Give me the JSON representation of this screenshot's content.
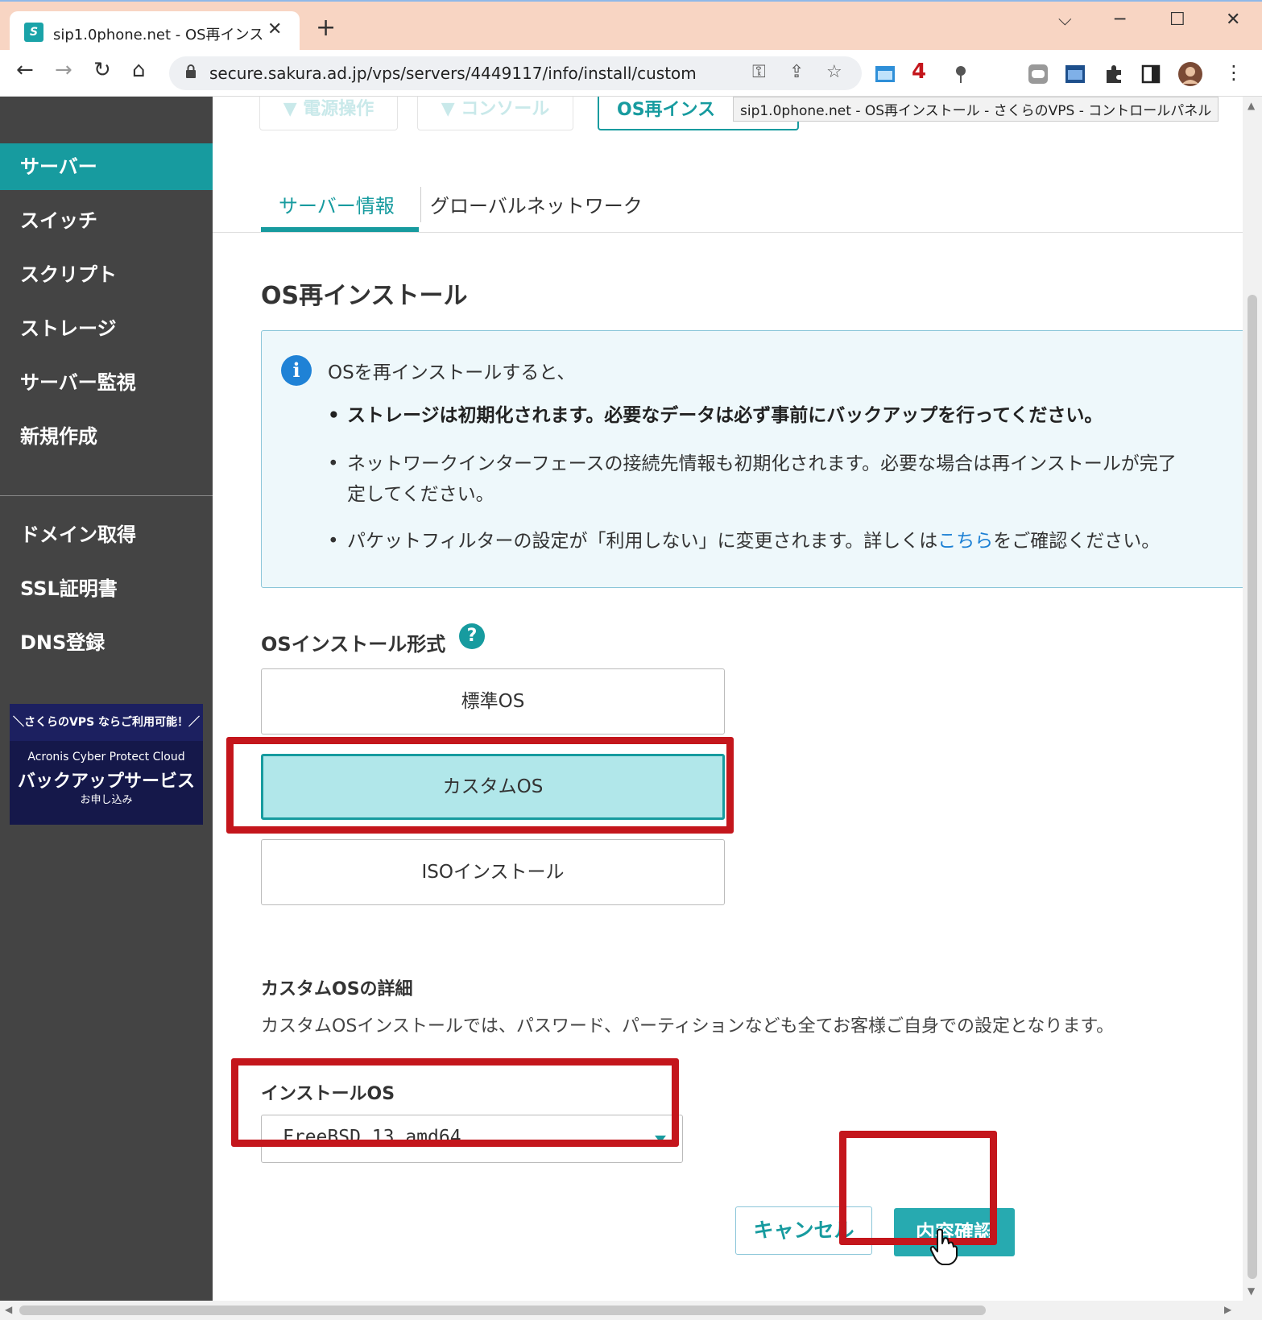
{
  "browser": {
    "tab_title": "sip1.0phone.net - OS再インストール",
    "tab_close": "✕",
    "new_tab": "+",
    "url": "secure.sakura.ad.jp/vps/servers/4449117/info/install/custom",
    "back": "←",
    "forward": "→",
    "reload": "↻",
    "home": "⌂",
    "min": "─",
    "max": "☐",
    "close": "✕",
    "tabsearch": "⌵",
    "key_icon": "⚿",
    "share_icon": "⇪",
    "star_icon": "☆",
    "ext_badge": "4",
    "menu_icon": "⋮"
  },
  "tooltip": "sip1.0phone.net - OS再インストール - さくらのVPS - コントロールパネル",
  "sidebar": {
    "items": [
      {
        "label": "サーバー"
      },
      {
        "label": "スイッチ"
      },
      {
        "label": "スクリプト"
      },
      {
        "label": "ストレージ"
      },
      {
        "label": "サーバー監視"
      },
      {
        "label": "新規作成"
      },
      {
        "label": "ドメイン取得"
      },
      {
        "label": "SSL証明書"
      },
      {
        "label": "DNS登録"
      }
    ],
    "banner": {
      "top": "＼さくらのVPS ならご利用可能！／",
      "sub": "Acronis Cyber Protect Cloud",
      "main": "バックアップサービス",
      "cta": "お申し込み"
    }
  },
  "top_buttons": {
    "power": "▼ 電源操作",
    "console": "▼ コンソール",
    "reinstall": "OS再インス"
  },
  "tabs": {
    "server_info": "サーバー情報",
    "global_network": "グローバルネットワーク"
  },
  "page_title": "OS再インストール",
  "info": {
    "intro": "OSを再インストールすると、",
    "bullet1": "ストレージは初期化されます。必要なデータは必ず事前にバックアップを行ってください。",
    "bullet2_line1": "ネットワークインターフェースの接続先情報も初期化されます。必要な場合は再インストールが完了",
    "bullet2_line2": "定してください。",
    "bullet3_pre": "パケットフィルターの設定が「利用しない」に変更されます。詳しくは",
    "bullet3_link": "こちら",
    "bullet3_post": "をご確認ください。"
  },
  "install_format": {
    "label": "OSインストール形式",
    "help": "?",
    "options": [
      {
        "label": "標準OS"
      },
      {
        "label": "カスタムOS"
      },
      {
        "label": "ISOインストール"
      }
    ],
    "selected": "カスタムOS"
  },
  "custom_detail": {
    "title": "カスタムOSの詳細",
    "text": "カスタムOSインストールでは、パスワード、パーティションなども全てお客様ご自身での設定となります。"
  },
  "install_os": {
    "label": "インストールOS",
    "value": "FreeBSD 13 amd64"
  },
  "actions": {
    "cancel": "キャンセル",
    "confirm": "内容確認"
  },
  "colors": {
    "accent": "#179b9f",
    "highlight": "#c4161c",
    "sidebar": "#444444",
    "selected_fill": "#b1e7ea"
  }
}
